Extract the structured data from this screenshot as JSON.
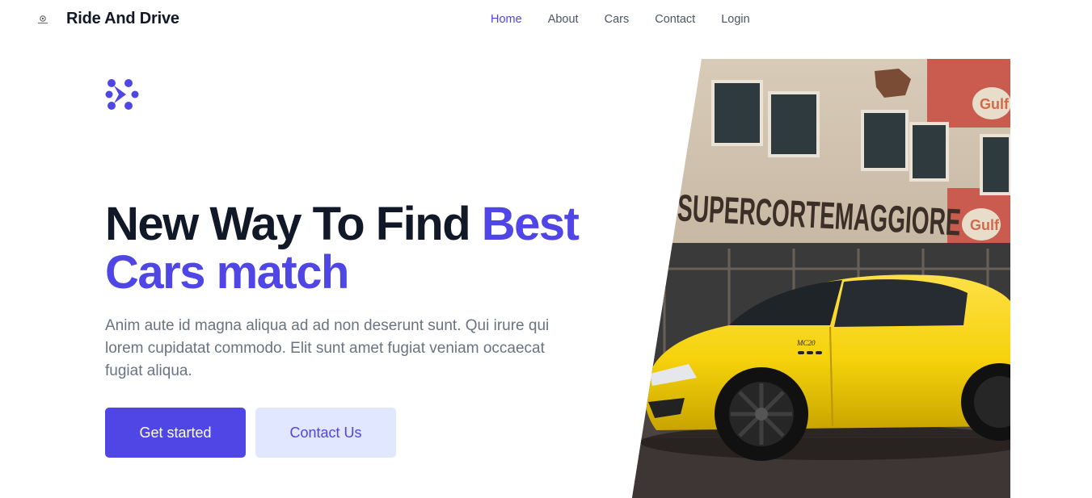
{
  "nav": {
    "brand_name": "Ride And Drive",
    "brand_icon": "brand-logo-icon",
    "links": [
      {
        "label": "Home",
        "active": true
      },
      {
        "label": "About",
        "active": false
      },
      {
        "label": "Cars",
        "active": false
      },
      {
        "label": "Contact",
        "active": false
      },
      {
        "label": "Login",
        "active": false
      }
    ]
  },
  "hero": {
    "mark_icon": "molecule-icon",
    "headline_part1": "New Way To Find ",
    "headline_accent": "Best Cars match",
    "description": "Anim aute id magna aliqua ad ad non deserunt sunt. Qui irure qui lorem cupidatat commodo. Elit sunt amet fugiat veniam occaecat fugiat aliqua.",
    "primary_button": "Get started",
    "secondary_button": "Contact Us",
    "image": {
      "alt": "Yellow sports car in front of building",
      "building_sign": "SUPERCORTEMAGGIORE",
      "sign_badge": "Gulf",
      "car_badge": "MC20"
    }
  },
  "colors": {
    "accent": "#4f46e5",
    "accent_light": "#e0e7ff",
    "text_dark": "#111827",
    "text_muted": "#6b7280",
    "car_yellow": "#f5d20a"
  }
}
